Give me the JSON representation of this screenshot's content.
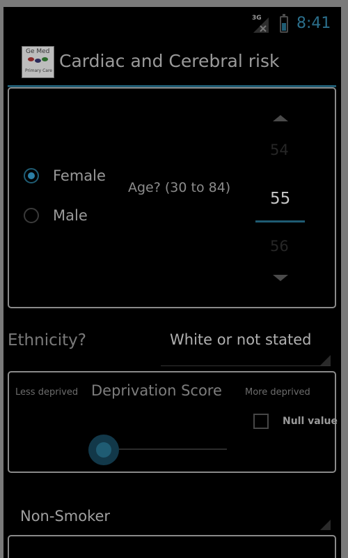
{
  "status_bar": {
    "network": "3G",
    "time": "8:41"
  },
  "header": {
    "logo_text": "Ge Med",
    "logo_subtext": "Primary Care",
    "title": "Cardiac and Cerebral risk"
  },
  "gender": {
    "options": [
      {
        "label": "Female",
        "selected": true
      },
      {
        "label": "Male",
        "selected": false
      }
    ]
  },
  "age": {
    "question": "Age? (30 to 84)",
    "prev": "54",
    "value": "55",
    "next": "56"
  },
  "ethnicity": {
    "label": "Ethnicity?",
    "value": "White or not stated"
  },
  "deprivation": {
    "less_label": "Less deprived",
    "title": "Deprivation Score",
    "more_label": "More deprived",
    "null_label": "Null value",
    "null_checked": false,
    "slider_value": 0
  },
  "smoking": {
    "value": "Non-Smoker"
  },
  "colors": {
    "accent": "#1f5c73",
    "background": "#000000"
  }
}
